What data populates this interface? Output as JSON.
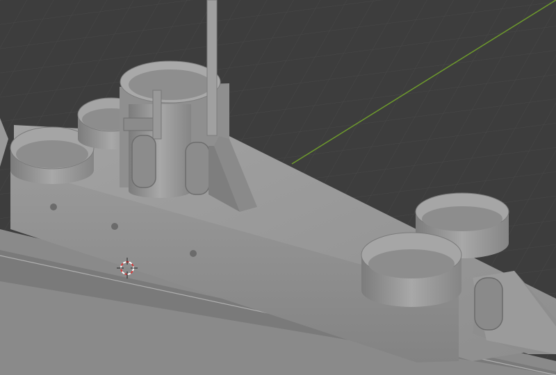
{
  "viewport": {
    "name": "3D Viewport",
    "background_color": "#3d3d3d",
    "grid_color": "#4a4a4a",
    "x_axis_color": "#6e9b2c",
    "model_base_color": "#8c8c8c",
    "model_shadow_color": "#6f6f6f",
    "model_highlight_color": "#b5b5b5"
  },
  "scene": {
    "object": "submarine-deck-model",
    "cursor_icon": "3d-cursor-icon"
  }
}
